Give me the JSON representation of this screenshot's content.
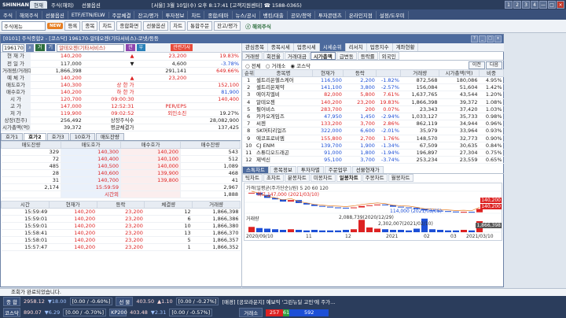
{
  "title": {
    "brand": "SHINHAN",
    "tabs": [
      "현재",
      "주식(해외)",
      "선물옵션"
    ],
    "center": "[서울] 3월 10일(수) 오후 8:17:41 [고객지원센터] ☎ 1588-0365)",
    "buttons": [
      "1",
      "2",
      "3",
      "4",
      "—",
      "□",
      "×"
    ]
  },
  "menu": [
    "주식",
    "해외주식",
    "선물옵션",
    "ETF/ETN/ELW",
    "주문체결",
    "잔고/평가",
    "투자정보",
    "차트",
    "종합/테마",
    "뉴스/공시",
    "뱅킹/대출",
    "공모/청약",
    "투자콘텐츠",
    "온라인지점",
    "설정/도우미"
  ],
  "toolbar": {
    "search_value": "주식메뉴",
    "new_badge": "NEW",
    "buttons": [
      "등록",
      "종목",
      "차트",
      "종합화면",
      "선물옵션",
      "차트",
      "통합주문",
      "잔고/평가"
    ],
    "logo": "ⓢ 해외주식"
  },
  "window": {
    "title": "[0101] 주식종합2 - [코스닥] 196170-알테오젠(기타서비스)-코넷/등등"
  },
  "left": {
    "code": "196170",
    "name": "알테오젠(기타서비스)",
    "code_pills": [
      "거",
      "기",
      "관",
      "우"
    ],
    "alert": "관련기사",
    "info_rows": [
      {
        "l1": "현 재 가",
        "v1": "140,200",
        "c1": "up",
        "mid1": "▲",
        "mid2": "23,200",
        "v2": "19.83%",
        "c2": "up"
      },
      {
        "l1": "전 일 가",
        "v1": "117,000",
        "c1": "",
        "mid1": "▼",
        "mid2": "4,600",
        "v2": "-3.78%",
        "c2": "dn"
      },
      {
        "l1": "거래량/거래대금",
        "v1": "1,866,398",
        "c1": "",
        "mid1": "",
        "mid2": "291,141",
        "v2": "649.66%",
        "c2": "up"
      },
      {
        "l1": "예 체 가",
        "v1": "140,200",
        "c1": "up",
        "mid1": "▲",
        "mid2": "23,200",
        "v2": "",
        "c2": ""
      },
      {
        "l1": "매도호가",
        "v1": "140,300",
        "c1": "up",
        "mid1": "상 한 가",
        "mid2": "",
        "v2": "152,100",
        "c2": "up"
      },
      {
        "l1": "매수호가",
        "v1": "140,200",
        "c1": "up",
        "mid1": "하 한 가",
        "mid2": "",
        "v2": "81,900",
        "c2": "dn"
      },
      {
        "l1": "시 가",
        "v1": "120,700",
        "c1": "up",
        "mid1": "09:00:30",
        "mid2": "",
        "v2": "140,400",
        "c2": "up"
      },
      {
        "l1": "고 가",
        "v1": "147,000",
        "c1": "up",
        "mid1": "12:52:31",
        "mid2": "PER/EPS",
        "v2": "",
        "c2": ""
      },
      {
        "l1": "저 가",
        "v1": "119,900",
        "c1": "up",
        "mid1": "09:02:52",
        "mid2": "외인소진",
        "v2": "19.27%",
        "c2": ""
      },
      {
        "l1": "상장(천주)",
        "v1": "256,492",
        "c1": "",
        "mid1": "상장주식수",
        "mid2": "",
        "v2": "28,082,900",
        "c2": ""
      },
      {
        "l1": "시가총액(억)",
        "v1": "39,372",
        "c1": "",
        "mid1": "평균체결가",
        "mid2": "",
        "v2": "137,425",
        "c2": ""
      }
    ],
    "book_tabs": [
      "호가1",
      "호가2",
      "호가3",
      "10호가",
      "매도잔량"
    ],
    "book_headers": [
      "매도잔량",
      "매도호가",
      "매수호가",
      "매수잔량"
    ],
    "book_rows": [
      {
        "a": "329",
        "ap": "140,300",
        "bp": "140,200",
        "b": "543"
      },
      {
        "a": "72",
        "ap": "140,400",
        "bp": "140,100",
        "b": "512"
      },
      {
        "a": "485",
        "ap": "140,500",
        "bp": "140,000",
        "b": "1,089"
      },
      {
        "a": "28",
        "ap": "140,600",
        "bp": "139,900",
        "b": "468"
      },
      {
        "a": "31",
        "ap": "140,700",
        "bp": "139,800",
        "b": "41"
      },
      {
        "a": "2,174",
        "ap": "15:59:59",
        "bp": "",
        "b": "2,967"
      },
      {
        "a": "",
        "ap": "시간외",
        "bp": "",
        "b": "1,888"
      }
    ],
    "trade_headers": [
      "시간",
      "현재가",
      "등락",
      "체결량",
      "거래량"
    ],
    "trades": [
      {
        "t": "15:59:49",
        "p": "140,200",
        "d": "23,200",
        "q": "12",
        "v": "1,866,398"
      },
      {
        "t": "15:59:01",
        "p": "140,200",
        "d": "23,200",
        "q": "6",
        "v": "1,866,386"
      },
      {
        "t": "15:59:01",
        "p": "140,200",
        "d": "23,200",
        "q": "10",
        "v": "1,866,380"
      },
      {
        "t": "15:58:41",
        "p": "140,200",
        "d": "23,200",
        "q": "13",
        "v": "1,866,370"
      },
      {
        "t": "15:58:01",
        "p": "140,200",
        "d": "23,200",
        "q": "5",
        "v": "1,866,357"
      },
      {
        "t": "15:57:47",
        "p": "140,200",
        "d": "23,200",
        "q": "1",
        "v": "1,866,352"
      }
    ]
  },
  "right": {
    "tabs1": [
      "관심종목",
      "종목시세",
      "업종시세",
      "시세순위",
      "리서치",
      "업종지수",
      "계좌현황"
    ],
    "tabs2": [
      "거래량",
      "회전율",
      "거래대금",
      "시가총액",
      "급변동",
      "등락률",
      "외국인"
    ],
    "radios": [
      "전체",
      "거래소",
      "코스닥"
    ],
    "nav": [
      "이전",
      "다음"
    ],
    "rank_headers": [
      "순위",
      "종목명",
      "현재가",
      "등락",
      "",
      "거래량",
      "시가총액(억)",
      "비중"
    ],
    "ranks": [
      {
        "r": "1",
        "n": "셀트리온헬스케어",
        "p": "116,500",
        "d": "2,200",
        "s": "-1.82%",
        "c": "dn",
        "v": "872,568",
        "m": "180,086",
        "w": "4.95%"
      },
      {
        "r": "2",
        "n": "셀트리온제약",
        "p": "141,100",
        "d": "3,800",
        "s": "-2.57%",
        "c": "dn",
        "v": "156,084",
        "m": "51,604",
        "w": "1.42%"
      },
      {
        "r": "3",
        "n": "에이치엘비",
        "p": "82,000",
        "d": "5,800",
        "s": "7.61%",
        "c": "up",
        "v": "1,637,765",
        "m": "43,544",
        "w": "1.20%"
      },
      {
        "r": "4",
        "n": "알테오젠",
        "p": "140,200",
        "d": "23,200",
        "s": "19.83%",
        "c": "up",
        "v": "1,866,398",
        "m": "39,372",
        "w": "1.08%"
      },
      {
        "r": "5",
        "n": "펄어비스",
        "p": "283,700",
        "d": "200",
        "s": "0.07%",
        "c": "up",
        "v": "23,343",
        "m": "37,420",
        "w": "1.03%"
      },
      {
        "r": "6",
        "n": "카카오게임즈",
        "p": "47,950",
        "d": "1,450",
        "s": "-2.94%",
        "c": "dn",
        "v": "1,033,127",
        "m": "35,733",
        "w": "0.98%"
      },
      {
        "r": "7",
        "n": "씨젠",
        "p": "133,200",
        "d": "3,700",
        "s": "2.86%",
        "c": "up",
        "v": "862,119",
        "m": "34,944",
        "w": "0.96%"
      },
      {
        "r": "8",
        "n": "SK머티리얼즈",
        "p": "322,000",
        "d": "6,600",
        "s": "-2.01%",
        "c": "dn",
        "v": "35,979",
        "m": "33,964",
        "w": "0.93%"
      },
      {
        "r": "9",
        "n": "에코프로비엠",
        "p": "155,800",
        "d": "2,700",
        "s": "1.76%",
        "c": "up",
        "v": "148,570",
        "m": "32,773",
        "w": "0.90%"
      },
      {
        "r": "10",
        "n": "CJ ENM",
        "p": "139,700",
        "d": "1,900",
        "s": "-1.34%",
        "c": "dn",
        "v": "67,509",
        "m": "30,635",
        "w": "0.84%"
      },
      {
        "r": "11",
        "n": "스튜디오드래곤",
        "p": "91,000",
        "d": "1,800",
        "s": "-1.94%",
        "c": "dn",
        "v": "196,897",
        "m": "27,304",
        "w": "0.75%"
      },
      {
        "r": "12",
        "n": "제넥신",
        "p": "95,100",
        "d": "3,700",
        "s": "-3.74%",
        "c": "dn",
        "v": "253,234",
        "m": "23,559",
        "w": "0.65%"
      }
    ],
    "chart_tabs": [
      "스톡차트",
      "종목정보",
      "투자자별",
      "주문업무",
      "선물현재가"
    ],
    "chart_tabs2": [
      "틱차트",
      "초차트",
      "분봉차트",
      "미봉차트",
      "일봉차트",
      "주봉차트",
      "월봉차트"
    ],
    "chart_legend": "가격(일평균(주가단순)/원)  5 20 60 120",
    "chart_high": "최고 147,000 (2021/03/10)",
    "chart_low": "114,000 (2021/03/05)",
    "vol_label": "거래량",
    "vol_max": "2,088,739(2020/12/29)",
    "vol_max2": "2,302,007(2021/02/10)",
    "price_tags": [
      "140,200",
      "140,200",
      "1,866,398"
    ],
    "x_labels": [
      "2020/09/10",
      "11",
      "12",
      "2021",
      "02",
      "03",
      "2021/03/10"
    ]
  },
  "statusline": "조회가 완료되었습니다.",
  "bottom": {
    "row1": {
      "l1": "종 합",
      "v1": "2958.12",
      "d1": "▼18.00",
      "p1": "[0.00 / -0.60%]",
      "l2": "선 물",
      "v2": "403.50",
      "d2": "▲1.10",
      "p2": "[0.00 / -0.27%]",
      "news": "[매경] [공모라운지] 예보익 '그린뉴딜 고민'에 주가..."
    },
    "row2": {
      "l1": "코스닥",
      "v1": "890.07",
      "d1": "▼6.29",
      "p1": "[0.00 / -0.70%]",
      "l2": "KP200",
      "v2": "403.48",
      "d2": "▼2.31",
      "p2": "[0.00 / -0.57%]",
      "label3": "거래소",
      "adv": "257",
      "flat": "61",
      "dec": "592"
    }
  },
  "chart_data": {
    "type": "candlestick",
    "x_labels": [
      "2020/09/10",
      "11",
      "12",
      "2021",
      "02",
      "03",
      "2021/03/10"
    ],
    "series": [
      {
        "name": "가격",
        "values": [
          250,
          235,
          215,
          205,
          190,
          200,
          180,
          170,
          160,
          155,
          150,
          148,
          145,
          150,
          160,
          165,
          170,
          165,
          155,
          150,
          148,
          140,
          130,
          128,
          125,
          122,
          118,
          120,
          117,
          140
        ]
      },
      {
        "name": "거래량",
        "values": [
          0.9,
          0.7,
          0.6,
          0.5,
          0.4,
          0.5,
          0.4,
          0.3,
          0.4,
          0.3,
          0.3,
          0.3,
          0.4,
          0.5,
          2.09,
          0.8,
          0.6,
          0.5,
          0.4,
          0.4,
          0.3,
          0.6,
          2.3,
          0.5,
          0.4,
          0.3,
          0.3,
          0.4,
          0.3,
          1.87
        ]
      }
    ],
    "annotations": [
      "최고 147,000 (2021/03/10)",
      "114,000 (2021/03/05)"
    ]
  }
}
